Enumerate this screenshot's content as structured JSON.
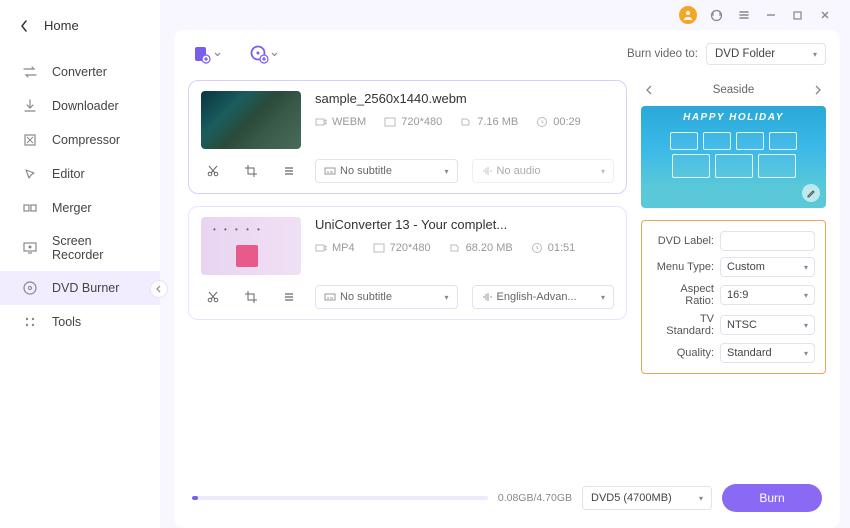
{
  "home_label": "Home",
  "sidebar": {
    "items": [
      {
        "label": "Converter"
      },
      {
        "label": "Downloader"
      },
      {
        "label": "Compressor"
      },
      {
        "label": "Editor"
      },
      {
        "label": "Merger"
      },
      {
        "label": "Screen Recorder"
      },
      {
        "label": "DVD Burner"
      },
      {
        "label": "Tools"
      }
    ]
  },
  "burn_to_label": "Burn video to:",
  "burn_to_value": "DVD Folder",
  "videos": [
    {
      "title": "sample_2560x1440.webm",
      "format": "WEBM",
      "resolution": "720*480",
      "size": "7.16 MB",
      "duration": "00:29",
      "subtitle": "No subtitle",
      "audio": "No audio"
    },
    {
      "title": "UniConverter 13 - Your complet...",
      "format": "MP4",
      "resolution": "720*480",
      "size": "68.20 MB",
      "duration": "01:51",
      "subtitle": "No subtitle",
      "audio": "English-Advan..."
    }
  ],
  "template": {
    "name": "Seaside",
    "banner_text": "HAPPY HOLIDAY"
  },
  "settings": {
    "dvd_label_label": "DVD Label:",
    "dvd_label_value": "",
    "menu_type_label": "Menu Type:",
    "menu_type_value": "Custom",
    "aspect_ratio_label": "Aspect Ratio:",
    "aspect_ratio_value": "16:9",
    "tv_standard_label": "TV Standard:",
    "tv_standard_value": "NTSC",
    "quality_label": "Quality:",
    "quality_value": "Standard"
  },
  "footer": {
    "progress_text": "0.08GB/4.70GB",
    "disc_value": "DVD5 (4700MB)",
    "burn_label": "Burn"
  }
}
